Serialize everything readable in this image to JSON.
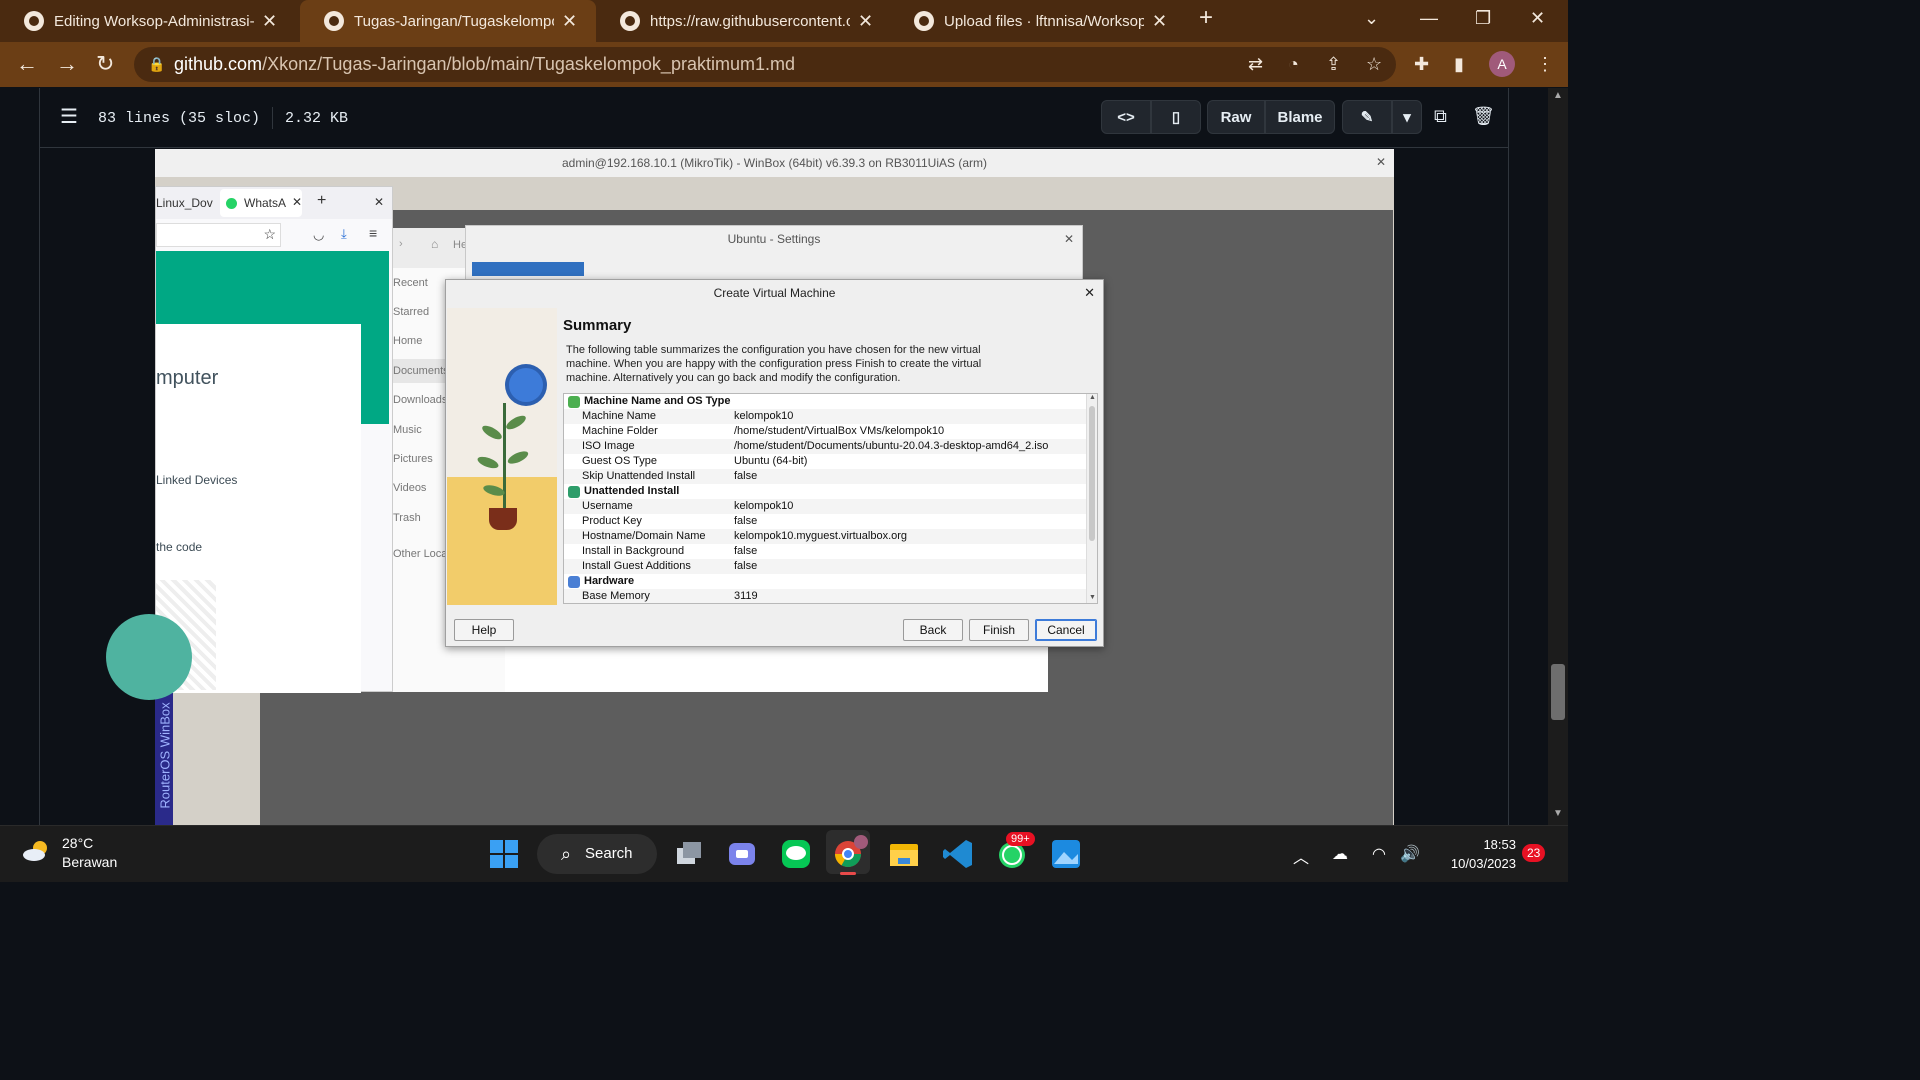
{
  "browser": {
    "tabs": [
      {
        "title": "Editing Worksop-Administrasi-Jar"
      },
      {
        "title": "Tugas-Jaringan/Tugaskelompok_"
      },
      {
        "title": "https://raw.githubusercontent.co"
      },
      {
        "title": "Upload files · lftnnisa/Worksop-A"
      }
    ],
    "url_host": "github.com",
    "url_path": "/Xkonz/Tugas-Jaringan/blob/main/Tugaskelompok_praktimum1.md",
    "avatar": "A"
  },
  "github": {
    "lines": "83 lines (35 sloc)",
    "size": "2.32 KB",
    "raw_label": "Raw",
    "blame_label": "Blame"
  },
  "winbox": {
    "title": "admin@192.168.10.1 (MikroTik) - WinBox (64bit) v6.39.3 on RB3011UiAS (arm)",
    "side_label": "RouterOS WinBox"
  },
  "firefox": {
    "tab1": "Linux_Dov",
    "tab2": "WhatsA",
    "heading": "mputer",
    "linked": "Linked Devices",
    "code": "the code"
  },
  "files": {
    "items": [
      "Recent",
      "Starred",
      "Home",
      "Documents",
      "Downloads",
      "Music",
      "Pictures",
      "Videos",
      "Trash",
      "Other Loca"
    ]
  },
  "ubuntu_settings": {
    "title": "Ubuntu - Settings"
  },
  "dialog": {
    "title": "Create Virtual Machine",
    "heading": "Summary",
    "description": "The following table summarizes the configuration you have chosen for the new virtual machine. When you are happy with the configuration press Finish to create the virtual machine. Alternatively you can go back and modify the configuration.",
    "sections": [
      {
        "name": "Machine Name and OS Type",
        "color": "#4caf50"
      },
      {
        "name": "Unattended Install",
        "color": "#2e9d6a"
      },
      {
        "name": "Hardware",
        "color": "#4a7fd4"
      }
    ],
    "rows": [
      {
        "key": "Machine Name",
        "value": "kelompok10"
      },
      {
        "key": "Machine Folder",
        "value": "/home/student/VirtualBox VMs/kelompok10"
      },
      {
        "key": "ISO Image",
        "value": "/home/student/Documents/ubuntu-20.04.3-desktop-amd64_2.iso"
      },
      {
        "key": "Guest OS Type",
        "value": "Ubuntu (64-bit)"
      },
      {
        "key": "Skip Unattended Install",
        "value": "false"
      },
      {
        "key": "Username",
        "value": "kelompok10"
      },
      {
        "key": "Product Key",
        "value": "false"
      },
      {
        "key": "Hostname/Domain Name",
        "value": "kelompok10.myguest.virtualbox.org"
      },
      {
        "key": "Install in Background",
        "value": "false"
      },
      {
        "key": "Install Guest Additions",
        "value": "false"
      },
      {
        "key": "Base Memory",
        "value": "3119"
      }
    ],
    "buttons": {
      "help": "Help",
      "back": "Back",
      "finish": "Finish",
      "cancel": "Cancel"
    }
  },
  "taskbar": {
    "temperature": "28°C",
    "weather": "Berawan",
    "search": "Search",
    "whatsapp_badge": "99+",
    "time": "18:53",
    "date": "10/03/2023",
    "notifications": "23"
  }
}
